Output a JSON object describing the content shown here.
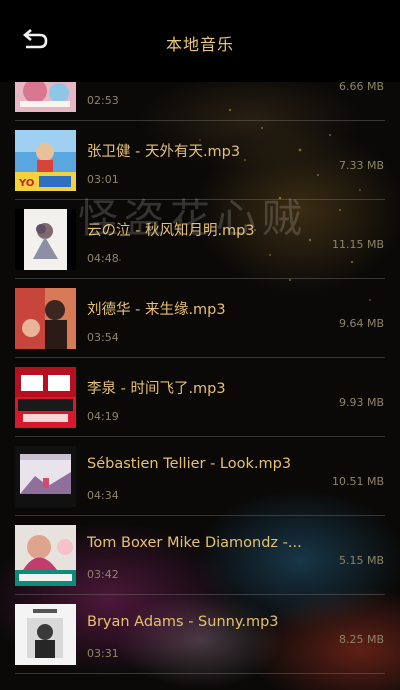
{
  "header": {
    "title": "本地音乐",
    "back_icon": "back-arrow-icon"
  },
  "watermark": "怪盗花心贼",
  "colors": {
    "accent_gold": "#e6c070",
    "header_bg": "#000000",
    "muted_text": "#8f8468"
  },
  "songs": [
    {
      "title": "",
      "duration": "02:53",
      "size": "6.66 MB",
      "cover_icon": "album-cover-image"
    },
    {
      "title": "张卫健 - 天外有天.mp3",
      "duration": "03:01",
      "size": "7.33 MB",
      "cover_icon": "album-cover-image"
    },
    {
      "title": "云の泣 - 秋风知月明.mp3",
      "duration": "04:48",
      "size": "11.15 MB",
      "cover_icon": "album-cover-image"
    },
    {
      "title": "刘德华 - 来生缘.mp3",
      "duration": "03:54",
      "size": "9.64 MB",
      "cover_icon": "album-cover-image"
    },
    {
      "title": "李泉 - 时间飞了.mp3",
      "duration": "04:19",
      "size": "9.93 MB",
      "cover_icon": "album-cover-image"
    },
    {
      "title": "Sébastien Tellier - Look.mp3",
      "duration": "04:34",
      "size": "10.51 MB",
      "cover_icon": "album-cover-image"
    },
    {
      "title": "Tom Boxer Mike Diamondz -...",
      "duration": "03:42",
      "size": "5.15 MB",
      "cover_icon": "album-cover-image"
    },
    {
      "title": "Bryan Adams - Sunny.mp3",
      "duration": "03:31",
      "size": "8.25 MB",
      "cover_icon": "album-cover-image"
    }
  ]
}
